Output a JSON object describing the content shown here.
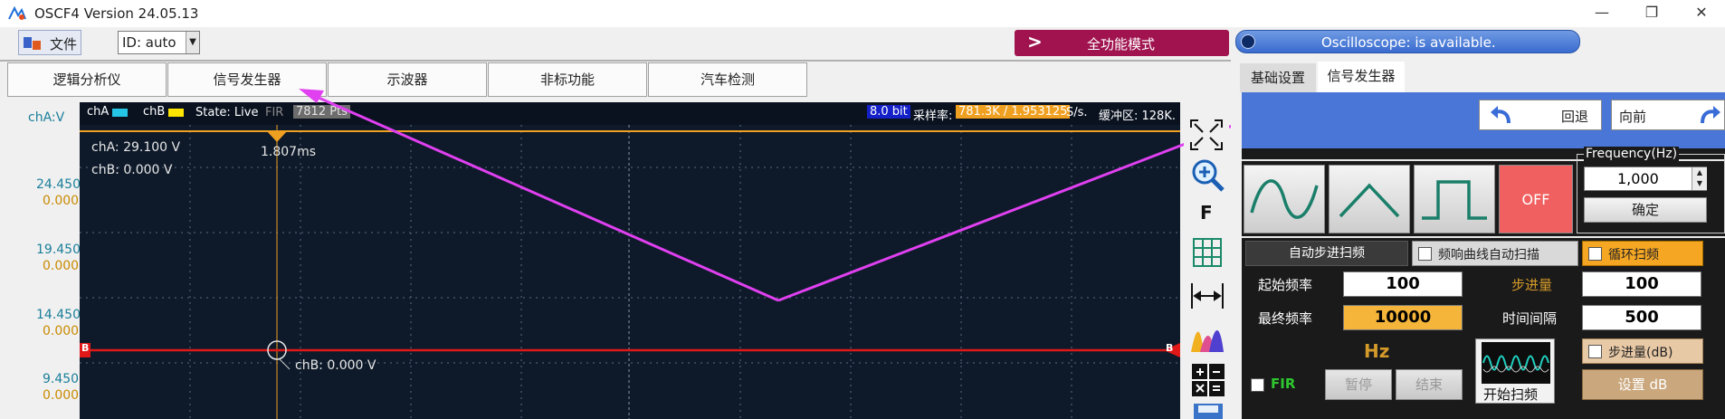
{
  "titlebar": {
    "title": "OSCF4  Version 24.05.13",
    "minimize": "—",
    "maximize": "❐",
    "close": "✕"
  },
  "toolbar": {
    "file_menu": "文件",
    "id_combo": "ID: auto",
    "mode_button": "全功能模式",
    "mode_arrow": ">",
    "status": "Oscilloscope:  is available."
  },
  "main_tabs": [
    {
      "label": "逻辑分析仪"
    },
    {
      "label": "信号发生器"
    },
    {
      "label": "示波器"
    },
    {
      "label": "非标功能"
    },
    {
      "label": "汽车检测"
    }
  ],
  "scope": {
    "y_unit": "chA:V",
    "ch_a": "chA",
    "ch_b": "chB",
    "state": "State: Live",
    "fir": "FIR",
    "points": "7812 Pts",
    "bits": "8.0 bit",
    "sample_label": "采样率:",
    "sample_rate": "781.3K / 1.953125",
    "sample_unit": "S/s.",
    "buffer": "缓冲区: 128K.",
    "cha_readout": "chA: 29.100 V",
    "chb_readout": "chB: 0.000 V",
    "cursor_time": "1.807ms",
    "cursor_chb": "chB: 0.000 V",
    "marker_b": "B",
    "y_ticks": [
      {
        "a": "24.450",
        "b": "0.000"
      },
      {
        "a": "19.450",
        "b": "0.000"
      },
      {
        "a": "14.450",
        "b": "0.000"
      },
      {
        "a": "9.450",
        "b": "0.000"
      }
    ],
    "colors": {
      "cha": "#25c5e6",
      "chb": "#ffe600",
      "trace": "#e01818",
      "cursor": "#f0a020",
      "annotation": "#e040f0"
    }
  },
  "side_tools": {
    "f_label": "F"
  },
  "right_panel": {
    "tabs": [
      {
        "label": "基础设置"
      },
      {
        "label": "信号发生器"
      }
    ],
    "back": "回退",
    "forward": "向前",
    "off": "OFF",
    "freq_label": "Frequency(Hz)",
    "freq_value": "1,000",
    "confirm": "确定",
    "auto_step": "自动步进扫频",
    "auto_scan": "频响曲线自动扫描",
    "loop_scan": "循环扫频",
    "start_freq_label": "起始频率",
    "start_freq": "100",
    "step_label": "步进量",
    "step_value": "100",
    "end_freq_label": "最终频率",
    "end_freq": "10000",
    "interval_label": "时间间隔",
    "interval_value": "500",
    "hz": "Hz",
    "step_db": "步进量(dB)",
    "fir": "FIR",
    "pause": "暂停",
    "end": "结束",
    "start_scan": "开始扫频",
    "set_db": "设置 dB"
  }
}
